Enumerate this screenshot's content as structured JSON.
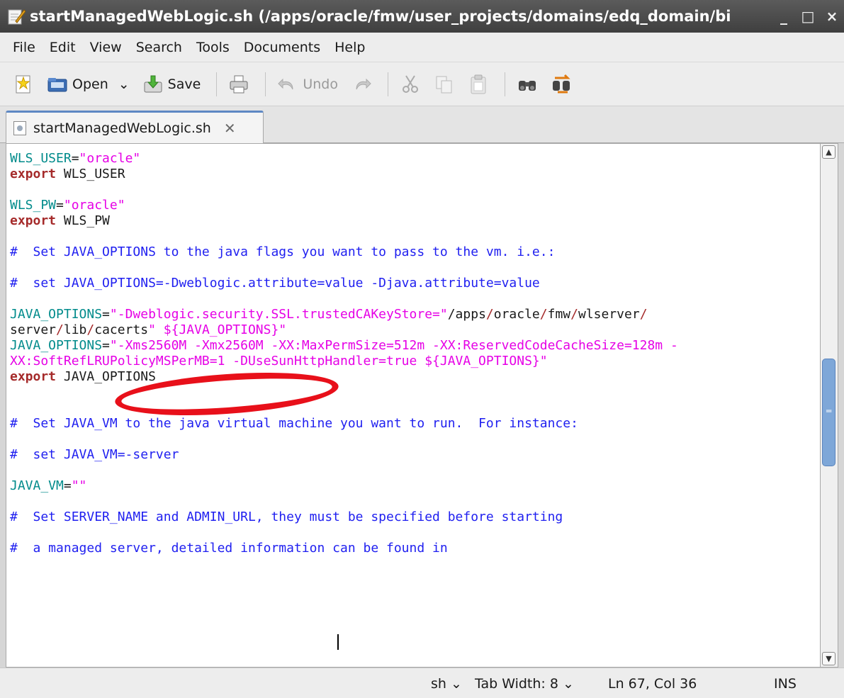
{
  "window": {
    "title": "startManagedWebLogic.sh (/apps/oracle/fmw/user_projects/domains/edq_domain/bi",
    "minimize": "_",
    "maximize": "□",
    "close": "×"
  },
  "menu": [
    "File",
    "Edit",
    "View",
    "Search",
    "Tools",
    "Documents",
    "Help"
  ],
  "toolbar": {
    "open_label": "Open",
    "open_dropdown": "⌄",
    "save_label": "Save",
    "undo_label": "Undo"
  },
  "tab": {
    "label": "startManagedWebLogic.sh",
    "close": "✕"
  },
  "editor": {
    "lines": [
      [
        [
          "var",
          "WLS_USER"
        ],
        [
          "plain",
          "="
        ],
        [
          "str",
          "\"oracle\""
        ]
      ],
      [
        [
          "kw",
          "export"
        ],
        [
          "plain",
          " WLS_USER"
        ]
      ],
      [],
      [
        [
          "var",
          "WLS_PW"
        ],
        [
          "plain",
          "="
        ],
        [
          "str",
          "\"oracle\""
        ]
      ],
      [
        [
          "kw",
          "export"
        ],
        [
          "plain",
          " WLS_PW"
        ]
      ],
      [],
      [
        [
          "com",
          "#  Set JAVA_OPTIONS to the java flags you want to pass to the vm. i.e.:"
        ]
      ],
      [],
      [
        [
          "com",
          "#  set JAVA_OPTIONS=-Dweblogic.attribute=value -Djava.attribute=value"
        ]
      ],
      [],
      [
        [
          "var",
          "JAVA_OPTIONS"
        ],
        [
          "plain",
          "="
        ],
        [
          "str",
          "\"-Dweblogic.security.SSL.trustedCAKeyStore=\""
        ],
        [
          "path",
          "/apps"
        ],
        [
          "slash",
          "/"
        ],
        [
          "path",
          "oracle"
        ],
        [
          "slash",
          "/"
        ],
        [
          "path",
          "fmw"
        ],
        [
          "slash",
          "/"
        ],
        [
          "path",
          "wlserver"
        ],
        [
          "slash",
          "/"
        ]
      ],
      [
        [
          "path",
          "server"
        ],
        [
          "slash",
          "/"
        ],
        [
          "path",
          "lib"
        ],
        [
          "slash",
          "/"
        ],
        [
          "path",
          "cacerts"
        ],
        [
          "str",
          "\" ${JAVA_OPTIONS}\""
        ]
      ],
      [
        [
          "var",
          "JAVA_OPTIONS"
        ],
        [
          "plain",
          "="
        ],
        [
          "str",
          "\"-Xms2560M -Xmx2560M -XX:MaxPermSize=512m -XX:ReservedCodeCacheSize=128m -"
        ]
      ],
      [
        [
          "str",
          "XX:SoftRefLRUPolicyMSPerMB=1 -DUseSunHttpHandler=true ${JAVA_OPTIONS}\""
        ]
      ],
      [
        [
          "kw",
          "export"
        ],
        [
          "plain",
          " JAVA_OPTIONS"
        ]
      ],
      [],
      [],
      [
        [
          "com",
          "#  Set JAVA_VM to the java virtual machine you want to run.  For instance:"
        ]
      ],
      [],
      [
        [
          "com",
          "#  set JAVA_VM=-server"
        ]
      ],
      [],
      [
        [
          "var",
          "JAVA_VM"
        ],
        [
          "plain",
          "="
        ],
        [
          "str",
          "\"\""
        ]
      ],
      [],
      [
        [
          "com",
          "#  Set SERVER_NAME and ADMIN_URL, they must be specified before starting"
        ]
      ],
      [],
      [
        [
          "com",
          "#  a managed server, detailed information can be found in"
        ]
      ]
    ]
  },
  "statusbar": {
    "language": "sh ⌄",
    "tab_width": "Tab Width:  8 ⌄",
    "position": "Ln 67, Col 36",
    "mode": "INS"
  }
}
